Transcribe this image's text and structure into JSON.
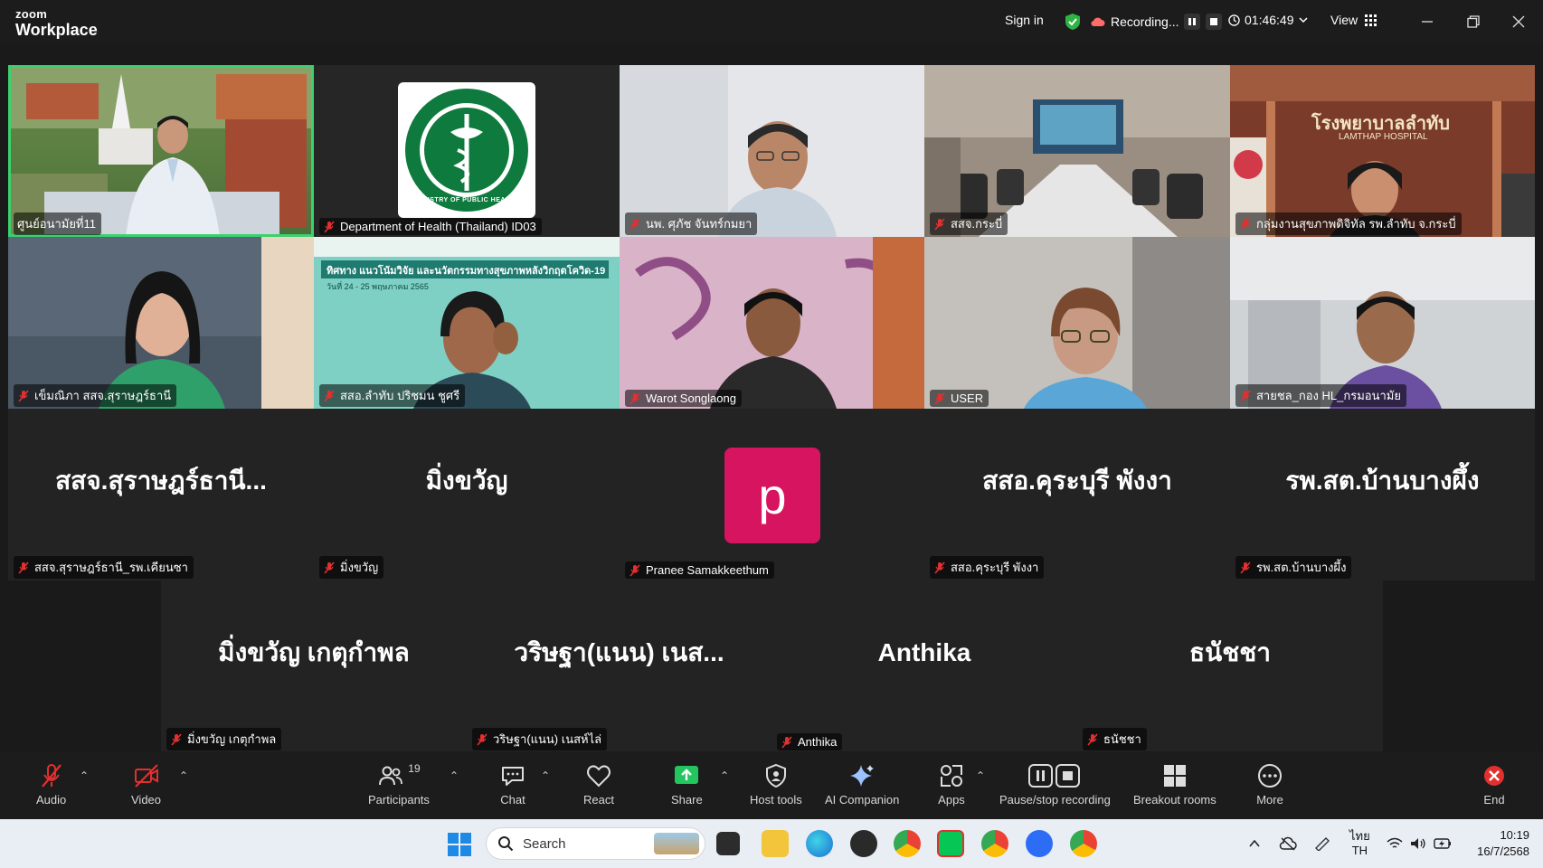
{
  "app": {
    "brand_small": "zoom",
    "brand_big": "Workplace"
  },
  "titlebar": {
    "sign_in": "Sign in",
    "recording": "Recording...",
    "timer": "01:46:49",
    "view": "View"
  },
  "video_tiles": [
    {
      "name": "ศูนย์อนามัยที่11"
    },
    {
      "name": "Department of Health (Thailand) ID03"
    },
    {
      "name": "นพ. ศุภัช จันทร์กมยา"
    },
    {
      "name": "สสจ.กระบี่"
    },
    {
      "name": "กลุ่มงานสุขภาพดิจิทัล รพ.ลำทับ จ.กระบี่"
    },
    {
      "name": "เข็มณิภา สสจ.สุราษฎร์ธานี"
    },
    {
      "name": "สสอ.ลำทับ ปริชมน ชูศรี"
    },
    {
      "name": "Warot Songlaong"
    },
    {
      "name": "USER"
    },
    {
      "name": "สายชล_กอง HL_กรมอนามัย"
    }
  ],
  "slide_text": {
    "banner": "ทิศทาง แนวโน้มวิจัย และนวัตกรรมทางสุขภาพหลังวิกฤตโควิด-19",
    "dates": "วันที่ 24 - 25 พฤษภาคม 2565"
  },
  "hospital_sign": {
    "thai": "โรงพยาบาลลำทับ",
    "english": "LAMTHAP HOSPITAL"
  },
  "logo_text": "MINISTRY OF PUBLIC HEALTH",
  "name_tiles_row1": [
    {
      "display": "สสจ.สุราษฎร์ธานี...",
      "label": "สสจ.สุราษฎร์ธานี_รพ.เคียนซา"
    },
    {
      "display": "มิ่งขวัญ",
      "label": "มิ่งขวัญ"
    },
    {
      "display": "p",
      "label": "Pranee Samakkeethum"
    },
    {
      "display": "สสอ.คุระบุรี พังงา",
      "label": "สสอ.คุระบุรี พังงา"
    },
    {
      "display": "รพ.สต.บ้านบางผึ้ง",
      "label": "รพ.สต.บ้านบางผึ้ง"
    }
  ],
  "name_tiles_row2": [
    {
      "display": "มิ่งขวัญ เกตุกำพล",
      "label": "มิ่งขวัญ เกตุกำพล"
    },
    {
      "display": "วริษฐา(แนน) เนส...",
      "label": "วริษฐา(แนน) เนสห์ไล่"
    },
    {
      "display": "Anthika",
      "label": "Anthika"
    },
    {
      "display": "ธนัชชา",
      "label": "ธนัชชา"
    }
  ],
  "toolbar": {
    "audio": "Audio",
    "video": "Video",
    "participants": "Participants",
    "participants_count": "19",
    "chat": "Chat",
    "react": "React",
    "share": "Share",
    "host_tools": "Host tools",
    "ai_companion": "AI Companion",
    "apps": "Apps",
    "pause_stop": "Pause/stop recording",
    "breakout": "Breakout rooms",
    "more": "More",
    "end": "End"
  },
  "taskbar": {
    "search": "Search",
    "lang_top": "ไทย",
    "lang_bottom": "TH",
    "time": "10:19",
    "date": "16/7/2568"
  },
  "colors": {
    "avatar_bg": "#d6145f",
    "active_border": "#3bd16f",
    "mic_off": "#e2302f",
    "share_green": "#22c55e"
  }
}
